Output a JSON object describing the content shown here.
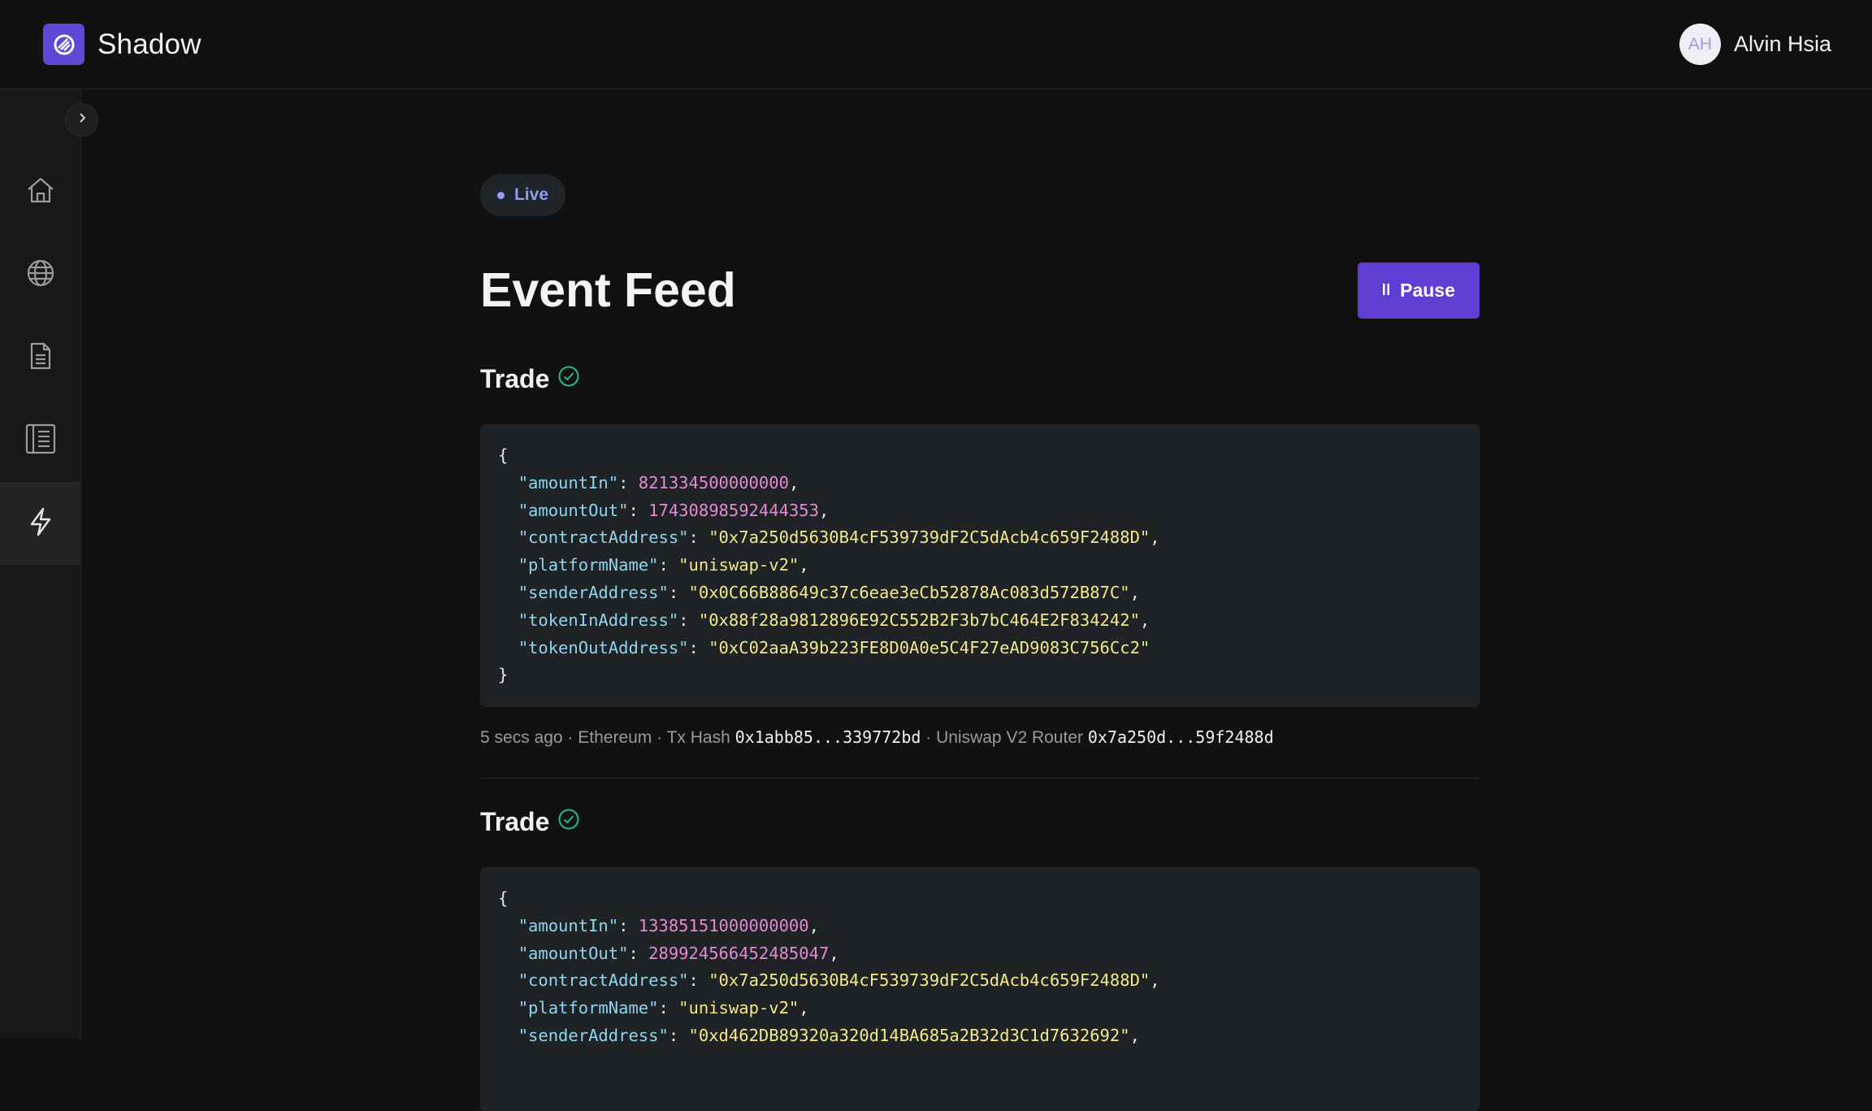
{
  "app": {
    "name": "Shadow"
  },
  "user": {
    "initials": "AH",
    "name": "Alvin Hsia"
  },
  "sidebar": {
    "items": [
      {
        "name": "home-icon",
        "active": false
      },
      {
        "name": "globe-icon",
        "active": false
      },
      {
        "name": "document-icon",
        "active": false
      },
      {
        "name": "list-icon",
        "active": false
      },
      {
        "name": "lightning-icon",
        "active": true
      }
    ]
  },
  "status": {
    "live_label": "Live"
  },
  "page": {
    "title": "Event Feed",
    "pause_label": "Pause"
  },
  "events": [
    {
      "title": "Trade",
      "json": {
        "open": "{",
        "close": "}",
        "fields": [
          {
            "key": "\"amountIn\"",
            "value": "821334500000000",
            "type": "number",
            "comma": ","
          },
          {
            "key": "\"amountOut\"",
            "value": "17430898592444353",
            "type": "number",
            "comma": ","
          },
          {
            "key": "\"contractAddress\"",
            "value": "\"0x7a250d5630B4cF539739dF2C5dAcb4c659F2488D\"",
            "type": "string",
            "comma": ","
          },
          {
            "key": "\"platformName\"",
            "value": "\"uniswap-v2\"",
            "type": "string",
            "comma": ","
          },
          {
            "key": "\"senderAddress\"",
            "value": "\"0x0C66B88649c37c6eae3eCb52878Ac083d572B87C\"",
            "type": "string",
            "comma": ","
          },
          {
            "key": "\"tokenInAddress\"",
            "value": "\"0x88f28a9812896E92C552B2F3b7bC464E2F834242\"",
            "type": "string",
            "comma": ","
          },
          {
            "key": "\"tokenOutAddress\"",
            "value": "\"0xC02aaA39b223FE8D0A0e5C4F27eAD9083C756Cc2\"",
            "type": "string",
            "comma": ""
          }
        ]
      },
      "meta": {
        "time": "5 secs ago",
        "sep": " · ",
        "network": "Ethereum",
        "tx_label": "Tx Hash",
        "tx_hash": "0x1abb85...339772bd",
        "contract_label": "Uniswap V2 Router",
        "contract_addr": "0x7a250d...59f2488d"
      }
    },
    {
      "title": "Trade",
      "json": {
        "open": "{",
        "fields": [
          {
            "key": "\"amountIn\"",
            "value": "13385151000000000",
            "type": "number",
            "comma": ","
          },
          {
            "key": "\"amountOut\"",
            "value": "289924566452485047",
            "type": "number",
            "comma": ","
          },
          {
            "key": "\"contractAddress\"",
            "value": "\"0x7a250d5630B4cF539739dF2C5dAcb4c659F2488D\"",
            "type": "string",
            "comma": ","
          },
          {
            "key": "\"platformName\"",
            "value": "\"uniswap-v2\"",
            "type": "string",
            "comma": ","
          },
          {
            "key": "\"senderAddress\"",
            "value": "\"0xd462DB89320a320d14BA685a2B32d3C1d7632692\"",
            "type": "string",
            "comma": ","
          }
        ]
      }
    }
  ],
  "colors": {
    "accent": "#5f3fd3",
    "live": "#8f9cf7",
    "check": "#1fbf85",
    "json_key": "#8fd5f0",
    "json_number": "#e28ad4",
    "json_string": "#f3e98a"
  }
}
